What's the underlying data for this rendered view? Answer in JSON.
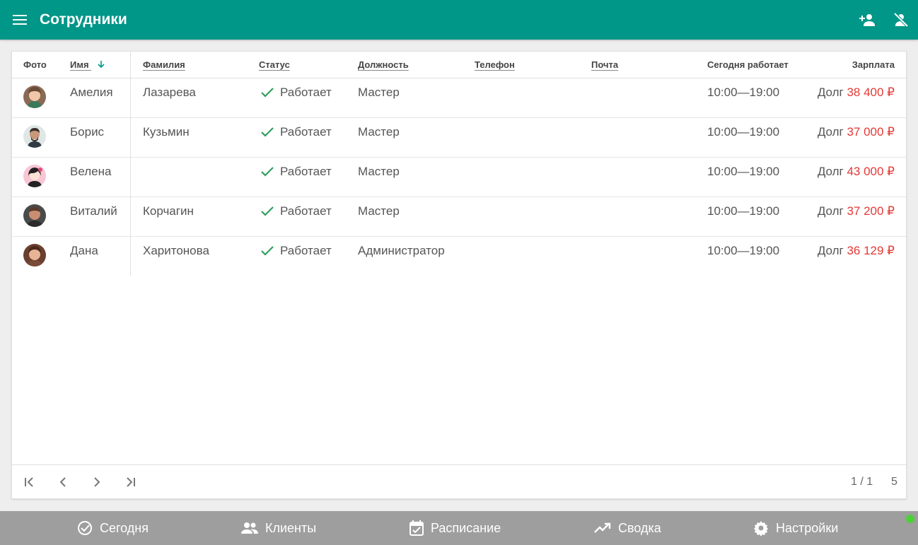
{
  "appbar": {
    "title": "Сотрудники",
    "bg": "#009688",
    "icons": [
      "menu-icon",
      "person-add-icon",
      "person-off-icon"
    ]
  },
  "table": {
    "columns": {
      "photo": "Фото",
      "first_name": "Имя",
      "last_name": "Фамилия",
      "status": "Статус",
      "position": "Должность",
      "phone": "Телефон",
      "email": "Почта",
      "today": "Сегодня работает",
      "salary": "Зарплата"
    },
    "sort": {
      "column": "first_name",
      "direction": "descending-arrow"
    },
    "rows": [
      {
        "first_name": "Амелия",
        "last_name": "Лазарева",
        "status": "Работает",
        "position": "Мастер",
        "phone": "",
        "email": "",
        "today": "10:00—19:00",
        "debt_label": "Долг",
        "salary": "38 400 ₽"
      },
      {
        "first_name": "Борис",
        "last_name": "Кузьмин",
        "status": "Работает",
        "position": "Мастер",
        "phone": "",
        "email": "",
        "today": "10:00—19:00",
        "debt_label": "Долг",
        "salary": "37 000 ₽"
      },
      {
        "first_name": "Велена",
        "last_name": "",
        "status": "Работает",
        "position": "Мастер",
        "phone": "",
        "email": "",
        "today": "10:00—19:00",
        "debt_label": "Долг",
        "salary": "43 000 ₽"
      },
      {
        "first_name": "Виталий",
        "last_name": "Корчагин",
        "status": "Работает",
        "position": "Мастер",
        "phone": "",
        "email": "",
        "today": "10:00—19:00",
        "debt_label": "Долг",
        "salary": "37 200 ₽"
      },
      {
        "first_name": "Дана",
        "last_name": "Харитонова",
        "status": "Работает",
        "position": "Администратор",
        "phone": "",
        "email": "",
        "today": "10:00—19:00",
        "debt_label": "Долг",
        "salary": "36 129 ₽"
      }
    ],
    "status_color": "#2e9e5b",
    "debt_color": "#e53935"
  },
  "pager": {
    "page": "1 / 1",
    "count": "5",
    "icons": [
      "first-page-icon",
      "prev-page-icon",
      "next-page-icon",
      "last-page-icon"
    ]
  },
  "bottom_nav": {
    "items": [
      {
        "label": "Сегодня",
        "icon": "check-circle-icon"
      },
      {
        "label": "Клиенты",
        "icon": "people-icon"
      },
      {
        "label": "Расписание",
        "icon": "calendar-check-icon"
      },
      {
        "label": "Сводка",
        "icon": "trending-up-icon"
      },
      {
        "label": "Настройки",
        "icon": "gear-icon"
      }
    ],
    "bg": "#9e9e9e"
  }
}
